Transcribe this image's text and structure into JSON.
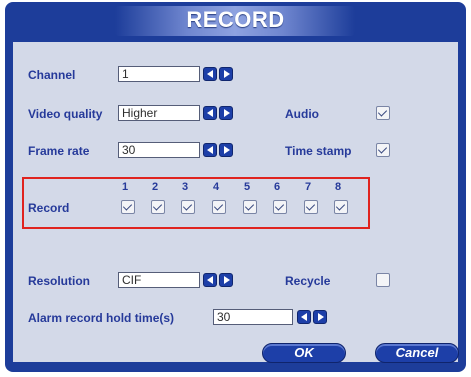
{
  "dialog": {
    "title": "RECORD",
    "channel": {
      "label": "Channel",
      "value": "1"
    },
    "video_quality": {
      "label": "Video quality",
      "value": "Higher"
    },
    "audio": {
      "label": "Audio",
      "checked": true
    },
    "frame_rate": {
      "label": "Frame rate",
      "value": "30"
    },
    "time_stamp": {
      "label": "Time stamp",
      "checked": true
    },
    "record": {
      "label": "Record",
      "channels": [
        {
          "number": "1",
          "checked": true
        },
        {
          "number": "2",
          "checked": true
        },
        {
          "number": "3",
          "checked": true
        },
        {
          "number": "4",
          "checked": true
        },
        {
          "number": "5",
          "checked": true
        },
        {
          "number": "6",
          "checked": true
        },
        {
          "number": "7",
          "checked": true
        },
        {
          "number": "8",
          "checked": true
        }
      ]
    },
    "resolution": {
      "label": "Resolution",
      "value": "CIF"
    },
    "recycle": {
      "label": "Recycle",
      "checked": false
    },
    "alarm_hold": {
      "label": "Alarm record hold time(s)",
      "value": "30"
    },
    "buttons": {
      "ok": "OK",
      "cancel": "Cancel"
    },
    "colors": {
      "frame": "#1d3d9a",
      "panel": "#d3d9e8",
      "label_text": "#263a9a",
      "highlight": "#e0231f"
    }
  }
}
